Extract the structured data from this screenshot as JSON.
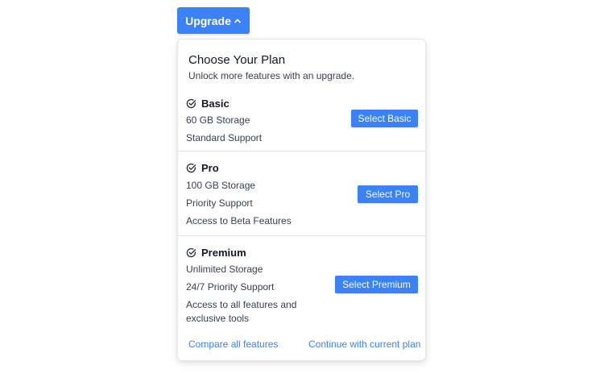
{
  "upgrade_button": {
    "label": "Upgrade",
    "icon": "chevron-up-icon"
  },
  "panel": {
    "title": "Choose Your Plan",
    "subtitle": "Unlock more features with an upgrade.",
    "plans": [
      {
        "name": "Basic",
        "icon": "check-circle-icon",
        "features": [
          "60 GB Storage",
          "Standard Support"
        ],
        "button_label": "Select Basic"
      },
      {
        "name": "Pro",
        "icon": "check-circle-icon",
        "features": [
          "100 GB Storage",
          "Priority Support",
          "Access to Beta Features"
        ],
        "button_label": "Select Pro"
      },
      {
        "name": "Premium",
        "icon": "check-circle-icon",
        "features": [
          "Unlimited Storage",
          "24/7 Priority Support",
          "Access to all features and exclusive tools"
        ],
        "button_label": "Select Premium"
      }
    ],
    "footer": {
      "compare_link": "Compare all features",
      "continue_link": "Continue with current plan"
    }
  },
  "colors": {
    "accent": "#3b82f6",
    "text": "#1f2937",
    "muted": "#374151",
    "border": "#e5e7eb"
  }
}
